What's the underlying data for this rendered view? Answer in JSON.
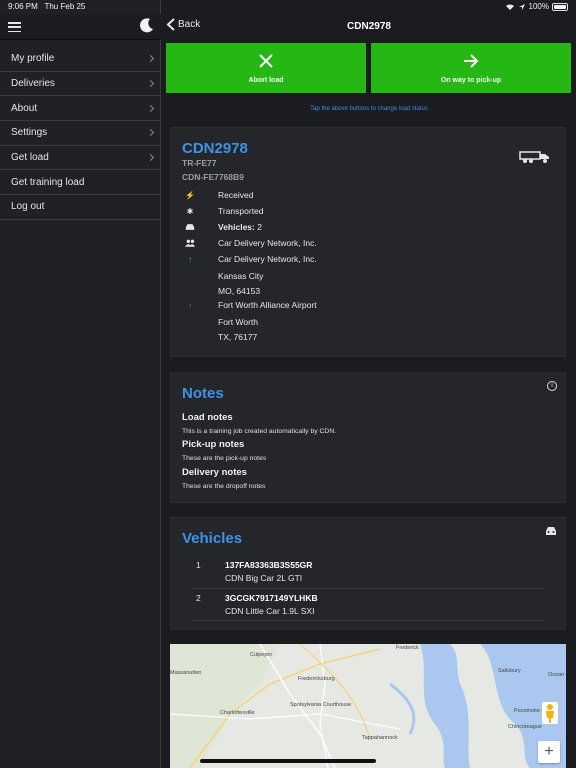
{
  "status_bar": {
    "time": "9:06 PM",
    "date": "Thu Feb 25",
    "battery": "100%"
  },
  "sidebar": {
    "items": [
      {
        "label": "My profile",
        "chevron": true
      },
      {
        "label": "Deliveries",
        "chevron": true
      },
      {
        "label": "About",
        "chevron": true
      },
      {
        "label": "Settings",
        "chevron": true
      },
      {
        "label": "Get load",
        "chevron": true
      },
      {
        "label": "Get training load",
        "chevron": false
      },
      {
        "label": "Log out",
        "chevron": false
      }
    ]
  },
  "header": {
    "back_label": "Back",
    "title": "CDN2978"
  },
  "actions": {
    "abort_label": "Abort load",
    "pickup_label": "On way to pick-up",
    "hint": "Tap the above buttons to change load status"
  },
  "load": {
    "code": "CDN2978",
    "trailer": "TR-FE77",
    "ref": "CDN-FE7768B9",
    "status_received": "Received",
    "status_transported": "Transported",
    "vehicles_label": "Vehicles:",
    "vehicles_count": "2",
    "shipper": "Car Delivery Network, Inc.",
    "pickup_name": "Car Delivery Network, Inc.",
    "pickup_city": "Kansas City",
    "pickup_zip": "MO, 64153",
    "dropoff_name": "Fort Worth Alliance Airport",
    "dropoff_city": "Fort Worth",
    "dropoff_zip": "TX, 76177"
  },
  "notes": {
    "title": "Notes",
    "load_notes_h": "Load notes",
    "load_notes": "This is a training job created automatically by CDN.",
    "pickup_notes_h": "Pick-up notes",
    "pickup_notes": "These are the pick-up notes",
    "delivery_notes_h": "Delivery notes",
    "delivery_notes": "These are the dropoff notes"
  },
  "vehicles": {
    "title": "Vehicles",
    "items": [
      {
        "num": "1",
        "vin": "137FA83363B3S55GR",
        "name": "CDN Big Car 2L GTI"
      },
      {
        "num": "2",
        "vin": "3GCGK7917149YLHKB",
        "name": "CDN Little Car 1.9L SXI"
      }
    ]
  },
  "map": {
    "labels": [
      "Culpeper",
      "Frederick",
      "Massanutten",
      "Fredericksburg",
      "Salisbury",
      "Ocean",
      "Charlottesville",
      "Spotsylvania Courthouse",
      "Tappahannock",
      "Pocomoke City",
      "Chincoteague"
    ],
    "zoom_in": "+"
  },
  "colors": {
    "accent": "#3d92ea",
    "action_green": "#25b814",
    "pickup_arrow": "#2ecc40",
    "dropoff_arrow": "#e64646"
  }
}
